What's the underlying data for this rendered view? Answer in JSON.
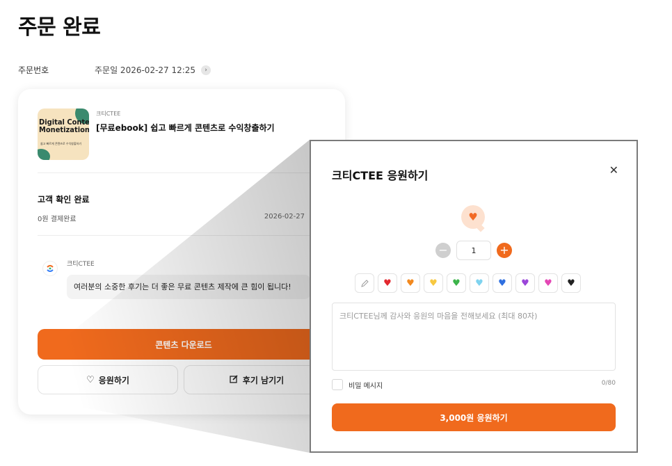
{
  "page": {
    "title": "주문 완료"
  },
  "order": {
    "number_label": "주문번호",
    "date_text": "주문일 2026-02-27 12:25",
    "product": {
      "seller": "크티CTEE",
      "name": "[무료ebook] 쉽고 빠르게 콘텐츠로 수익창출하기",
      "thumb_title": "Digital Content Monetization",
      "thumb_subtitle": "쉽고 빠르게 콘텐츠로 수익창출하기"
    },
    "status": {
      "title": "고객 확인 완료",
      "payment": "0원 결제완료",
      "date": "2026-02-27"
    },
    "seller_message": {
      "seller": "크티CTEE",
      "text": "여러분의 소중한 후기는 더 좋은 무료 콘텐츠 제작에 큰 힘이 됩니다!"
    },
    "buttons": {
      "download": "콘텐츠 다운로드",
      "support": "응원하기",
      "review": "후기 남기기"
    }
  },
  "modal": {
    "title": "크티CTEE 응원하기",
    "quantity": "1",
    "hearts": [
      "pencil",
      "red",
      "orange",
      "yellow",
      "green",
      "light-blue",
      "blue",
      "purple",
      "pink",
      "black"
    ],
    "heart_colors": {
      "red": "#e3282f",
      "orange": "#f2891f",
      "yellow": "#f7c840",
      "green": "#3cb44a",
      "light-blue": "#7fd3ef",
      "blue": "#2f6fe0",
      "purple": "#9b46d9",
      "pink": "#e447b5",
      "black": "#222222"
    },
    "message_placeholder": "크티CTEE님께 감사와 응원의 마음을 전해보세요 (최대 80자)",
    "secret_label": "비밀 메시지",
    "char_count": "0/80",
    "submit": "3,000원 응원하기"
  },
  "colors": {
    "accent": "#f06a1d"
  }
}
